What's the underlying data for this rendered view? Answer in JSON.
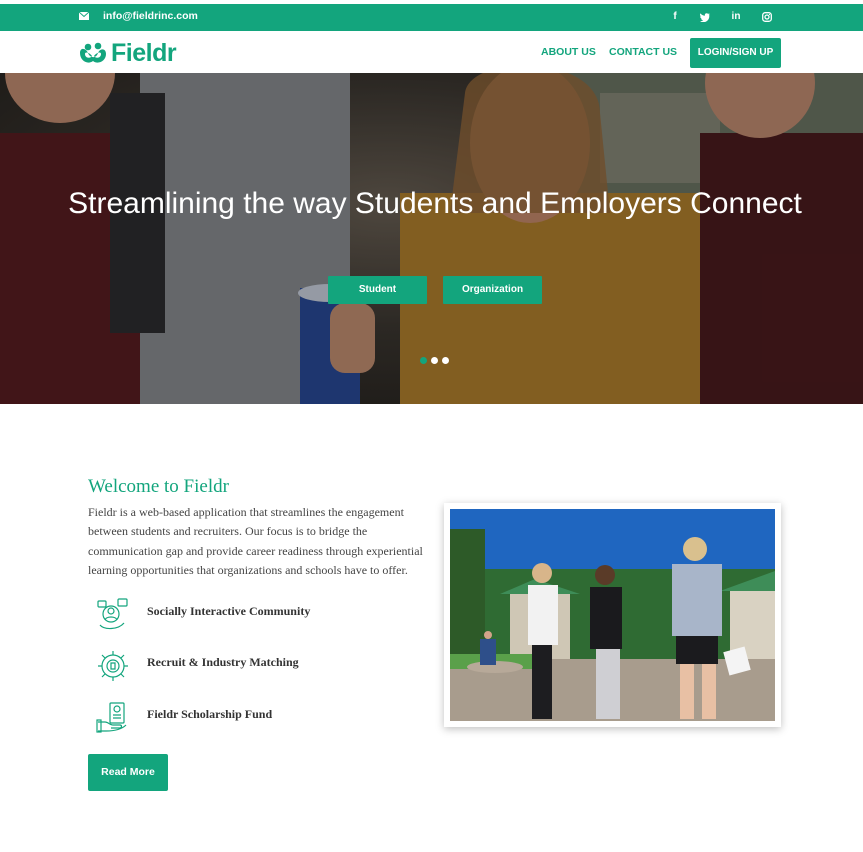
{
  "topbar": {
    "email": "info@fieldrinc.com",
    "social": [
      "f",
      "t",
      "in",
      "ig"
    ]
  },
  "nav": {
    "logo_text": "Fieldr",
    "about_label": "ABOUT US",
    "contact_label": "CONTACT US",
    "login_label": "LOGIN/SIGN UP"
  },
  "hero": {
    "title": "Streamlining the way Students and Employers Connect",
    "student_label": "Student",
    "organization_label": "Organization",
    "slides": 3,
    "active_slide": 1
  },
  "welcome": {
    "title": "Welcome to Fieldr",
    "body": "Fieldr is a web-based application that streamlines the engagement between students and recruiters. Our focus is to bridge the communication gap and provide career readiness through experiential learning opportunities that organizations and schools have to offer.",
    "features": [
      {
        "label": "Socially Interactive Community",
        "icon": "community-icon"
      },
      {
        "label": "Recruit & Industry Matching",
        "icon": "gear-matching-icon"
      },
      {
        "label": "Fieldr Scholarship Fund",
        "icon": "scholarship-icon"
      }
    ],
    "read_more_label": "Read More"
  },
  "colors": {
    "brand": "#13a57d"
  }
}
